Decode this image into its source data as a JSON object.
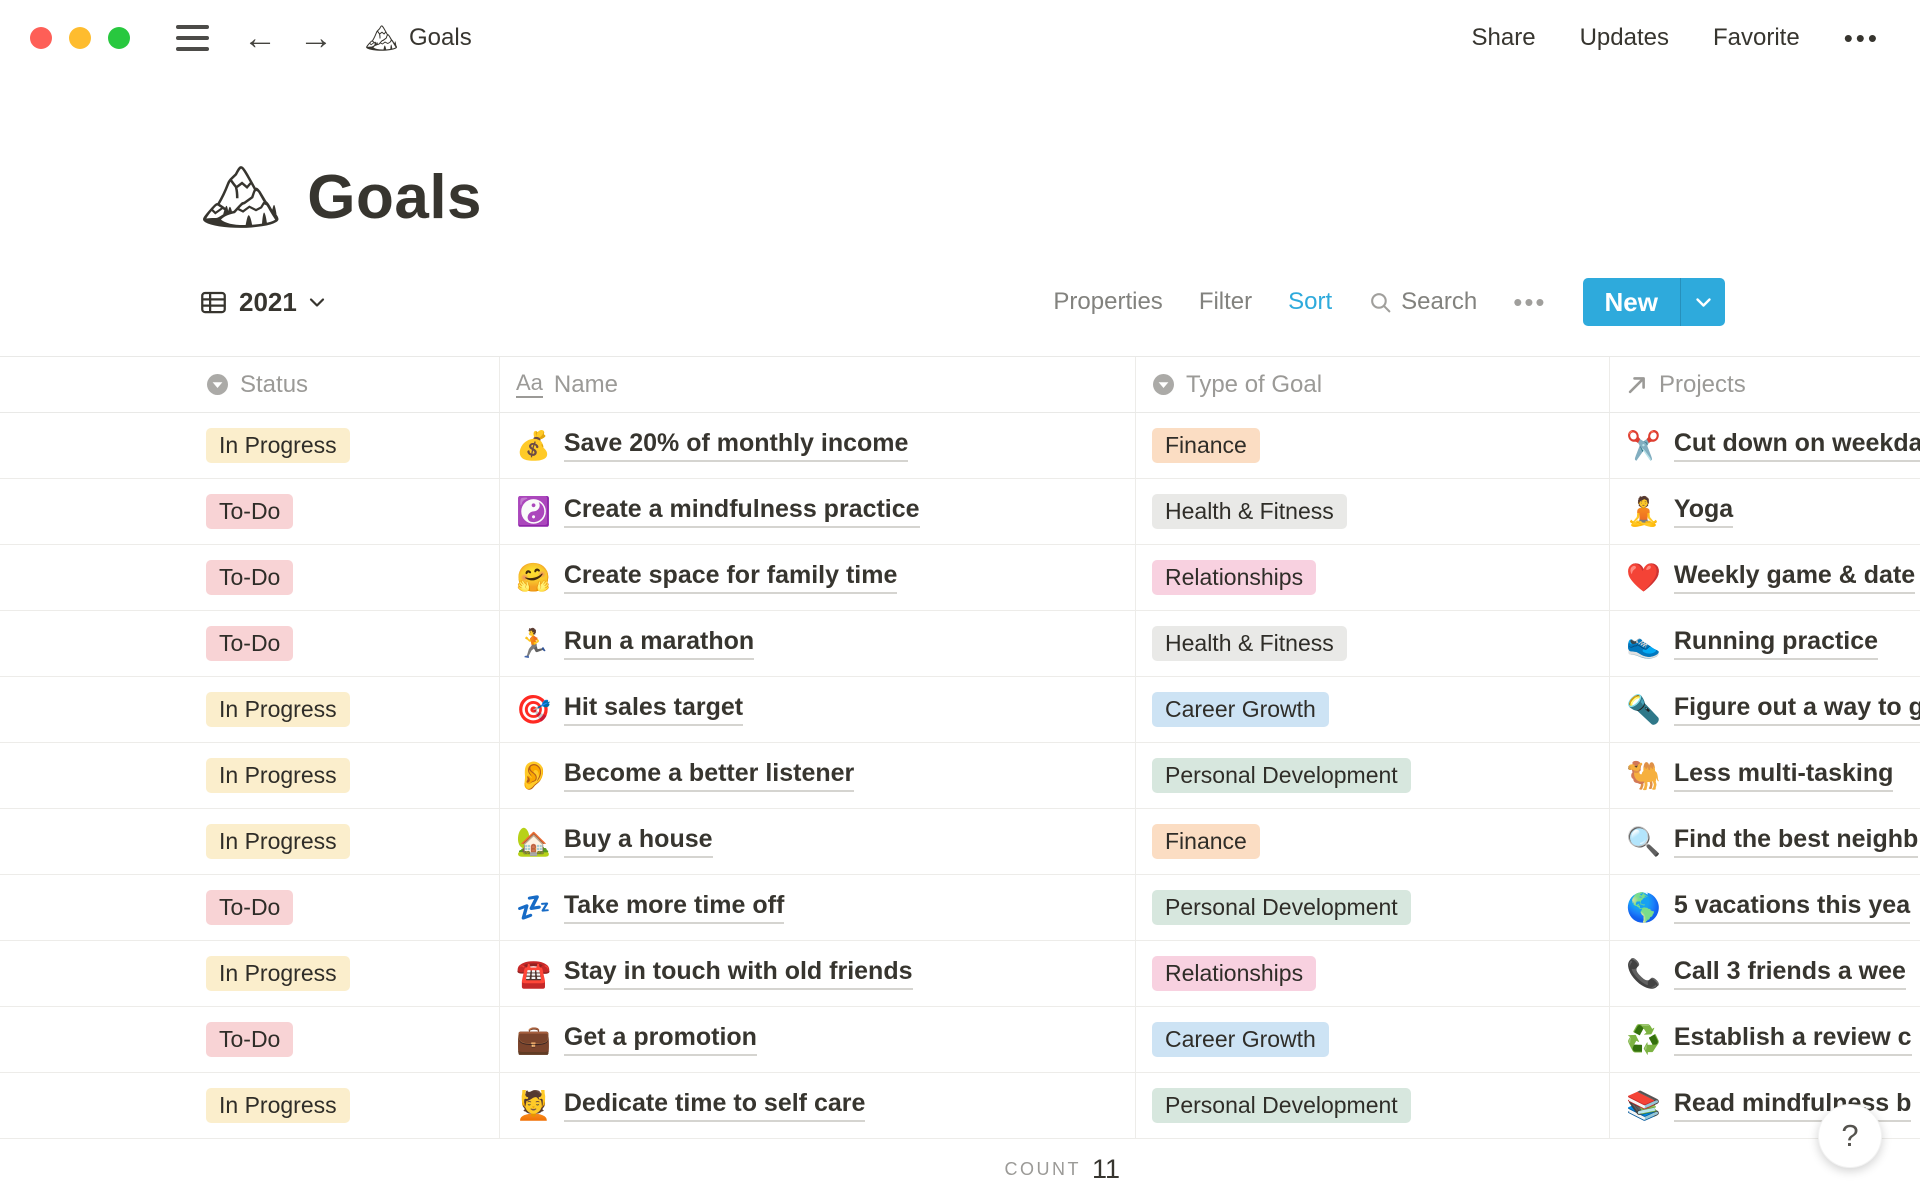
{
  "window": {
    "breadcrumb_icon": "🏔",
    "breadcrumb_title": "Goals",
    "share": "Share",
    "updates": "Updates",
    "favorite": "Favorite",
    "more": "•••"
  },
  "page": {
    "icon": "🏔",
    "title": "Goals"
  },
  "toolbar": {
    "view_name": "2021",
    "properties": "Properties",
    "filter": "Filter",
    "sort": "Sort",
    "search": "Search",
    "more": "•••",
    "new": "New",
    "accent_color": "#2EAADC"
  },
  "table": {
    "columns": [
      {
        "label": "Status",
        "icon": "select-icon"
      },
      {
        "label": "Name",
        "icon": "title-icon"
      },
      {
        "label": "Type of Goal",
        "icon": "select-icon"
      },
      {
        "label": "Projects",
        "icon": "relation-icon"
      }
    ],
    "status_colors": {
      "In Progress": "#FBEECC",
      "To-Do": "#F8D3D5"
    },
    "type_colors": {
      "Finance": "#FBDDC3",
      "Health & Fitness": "#E9E9E7",
      "Relationships": "#F8D1E0",
      "Career Growth": "#CDE3F4",
      "Personal Development": "#D7E7DE"
    },
    "rows": [
      {
        "status": "In Progress",
        "name_emoji": "💰",
        "name": "Save 20% of monthly income",
        "type": "Finance",
        "project_emoji": "✂️",
        "project": "Cut down on weekda"
      },
      {
        "status": "To-Do",
        "name_emoji": "☯️",
        "name": "Create a mindfulness practice",
        "type": "Health & Fitness",
        "project_emoji": "🧘",
        "project": "Yoga"
      },
      {
        "status": "To-Do",
        "name_emoji": "🤗",
        "name": "Create space for family time",
        "type": "Relationships",
        "project_emoji": "❤️",
        "project": "Weekly game & date"
      },
      {
        "status": "To-Do",
        "name_emoji": "🏃",
        "name": "Run a marathon",
        "type": "Health & Fitness",
        "project_emoji": "👟",
        "project": "Running practice"
      },
      {
        "status": "In Progress",
        "name_emoji": "🎯",
        "name": "Hit sales target",
        "type": "Career Growth",
        "project_emoji": "🔦",
        "project": "Figure out a way to g"
      },
      {
        "status": "In Progress",
        "name_emoji": "👂",
        "name": "Become a better listener",
        "type": "Personal Development",
        "project_emoji": "🐫",
        "project": "Less multi-tasking"
      },
      {
        "status": "In Progress",
        "name_emoji": "🏡",
        "name": "Buy a house",
        "type": "Finance",
        "project_emoji": "🔍",
        "project": "Find the best neighb"
      },
      {
        "status": "To-Do",
        "name_emoji": "💤",
        "name": "Take more time off",
        "type": "Personal Development",
        "project_emoji": "🌎",
        "project": "5 vacations this yea"
      },
      {
        "status": "In Progress",
        "name_emoji": "☎️",
        "name": "Stay in touch with old friends",
        "type": "Relationships",
        "project_emoji": "📞",
        "project": "Call 3 friends a wee"
      },
      {
        "status": "To-Do",
        "name_emoji": "💼",
        "name": "Get a promotion",
        "type": "Career Growth",
        "project_emoji": "♻️",
        "project": "Establish a review c"
      },
      {
        "status": "In Progress",
        "name_emoji": "💆",
        "name": "Dedicate time to self care",
        "type": "Personal Development",
        "project_emoji": "📚",
        "project": "Read mindfulness b"
      }
    ],
    "footer": {
      "count_label": "COUNT",
      "count_value": "11"
    }
  },
  "help": {
    "label": "?"
  }
}
